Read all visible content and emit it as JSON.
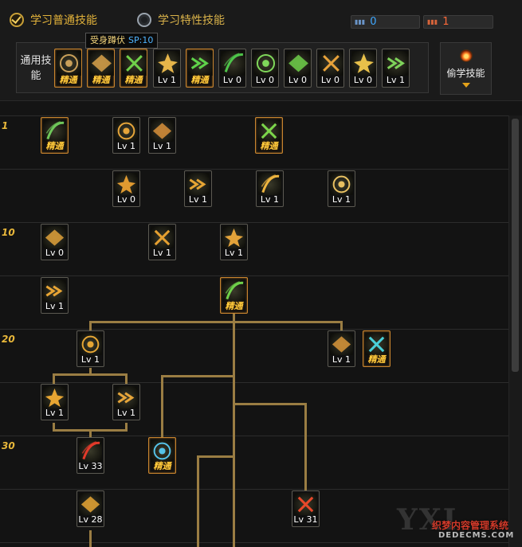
{
  "tabs": [
    {
      "label": "学习普通技能",
      "selected": true
    },
    {
      "label": "学习特性技能",
      "selected": false
    }
  ],
  "counters": [
    {
      "icon": "sp-gauge-icon",
      "value": "0",
      "color": "#3fa8ff"
    },
    {
      "icon": "tp-gauge-icon",
      "value": "1",
      "color": "#ff6a3a"
    }
  ],
  "tooltip": {
    "name": "受身蹲伏",
    "sp": "SP:10"
  },
  "general": {
    "label": "通用技能",
    "skills": [
      {
        "icon": "crouch-recover-icon",
        "caption": "精通",
        "elite": true,
        "tint": "#c9a05a"
      },
      {
        "icon": "leap-icon",
        "caption": "精通",
        "elite": true,
        "tint": "#d9a24a"
      },
      {
        "icon": "dash-strike-icon",
        "caption": "精通",
        "elite": true,
        "tint": "#6fd14a"
      },
      {
        "icon": "wings-icon",
        "caption": "Lv 1",
        "elite": false,
        "tint": "#e6b54a"
      },
      {
        "icon": "target-circle-icon",
        "caption": "精通",
        "elite": true,
        "tint": "#5fd34a"
      },
      {
        "icon": "target-circle-icon",
        "caption": "Lv 0",
        "elite": false,
        "tint": "#4ec44a"
      },
      {
        "icon": "burst-figure-icon",
        "caption": "Lv 0",
        "elite": false,
        "tint": "#7fd85a"
      },
      {
        "icon": "meditate-icon",
        "caption": "Lv 0",
        "elite": false,
        "tint": "#6fcf4a"
      },
      {
        "icon": "eye-ring-icon",
        "caption": "Lv 0",
        "elite": false,
        "tint": "#e8a23a"
      },
      {
        "icon": "power-figure-icon",
        "caption": "Lv 0",
        "elite": false,
        "tint": "#e8c04a"
      },
      {
        "icon": "slash-figure-icon",
        "caption": "Lv 1",
        "elite": false,
        "tint": "#7ed35a"
      }
    ]
  },
  "steal_button": {
    "label": "偷学技能",
    "icon": "flame-orb-icon"
  },
  "levels": [
    "1",
    "10",
    "20",
    "30"
  ],
  "tree_skills": [
    {
      "icon": "demon-rune-icon",
      "caption": "精通",
      "elite": true,
      "tint": "#6fc85a"
    },
    {
      "icon": "crescent-slash-icon",
      "caption": "Lv 1",
      "elite": false,
      "tint": "#e6a53a"
    },
    {
      "icon": "crescent-slash-icon",
      "caption": "Lv 1",
      "elite": false,
      "tint": "#d8913a"
    },
    {
      "icon": "green-burst-icon",
      "caption": "精通",
      "elite": true,
      "tint": "#7cd64a"
    },
    {
      "icon": "claw-strike-icon",
      "caption": "Lv 0",
      "elite": false,
      "tint": "#e09a30"
    },
    {
      "icon": "triple-arrow-icon",
      "caption": "Lv 1",
      "elite": false,
      "tint": "#e6a534"
    },
    {
      "icon": "sweep-slash-icon",
      "caption": "Lv 1",
      "elite": false,
      "tint": "#efb53f"
    },
    {
      "icon": "holy-shield-icon",
      "caption": "Lv 1",
      "elite": false,
      "tint": "#e8c061"
    },
    {
      "icon": "twin-slash-icon",
      "caption": "Lv 0",
      "elite": false,
      "tint": "#e0a13a"
    },
    {
      "icon": "vortex-icon",
      "caption": "Lv 1",
      "elite": false,
      "tint": "#e6a030"
    },
    {
      "icon": "spirit-icon",
      "caption": "Lv 1",
      "elite": false,
      "tint": "#e3a33a"
    },
    {
      "icon": "swift-slash-icon",
      "caption": "Lv 1",
      "elite": false,
      "tint": "#e8a534"
    },
    {
      "icon": "green-whirl-icon",
      "caption": "精通",
      "elite": true,
      "tint": "#6fd14a"
    },
    {
      "icon": "arc-slash-icon",
      "caption": "Lv 1",
      "elite": false,
      "tint": "#e6a634"
    },
    {
      "icon": "blade-pillar-icon",
      "caption": "Lv 1",
      "elite": false,
      "tint": "#d9963a"
    },
    {
      "icon": "shadow-demon-icon",
      "caption": "精通",
      "elite": true,
      "tint": "#4ad0d8"
    },
    {
      "icon": "moon-slash-icon",
      "caption": "Lv 1",
      "elite": false,
      "tint": "#e8a632"
    },
    {
      "icon": "multi-blade-icon",
      "caption": "Lv 1",
      "elite": false,
      "tint": "#e6a53a"
    },
    {
      "icon": "blood-crescent-icon",
      "caption": "Lv 33",
      "elite": false,
      "tint": "#e33a2a"
    },
    {
      "icon": "blue-wind-icon",
      "caption": "精通",
      "elite": true,
      "tint": "#55c2e8"
    },
    {
      "icon": "golden-arc-icon",
      "caption": "Lv 28",
      "elite": false,
      "tint": "#e8a634"
    },
    {
      "icon": "blood-demon-icon",
      "caption": "Lv 31",
      "elite": false,
      "tint": "#e8482a"
    }
  ]
}
